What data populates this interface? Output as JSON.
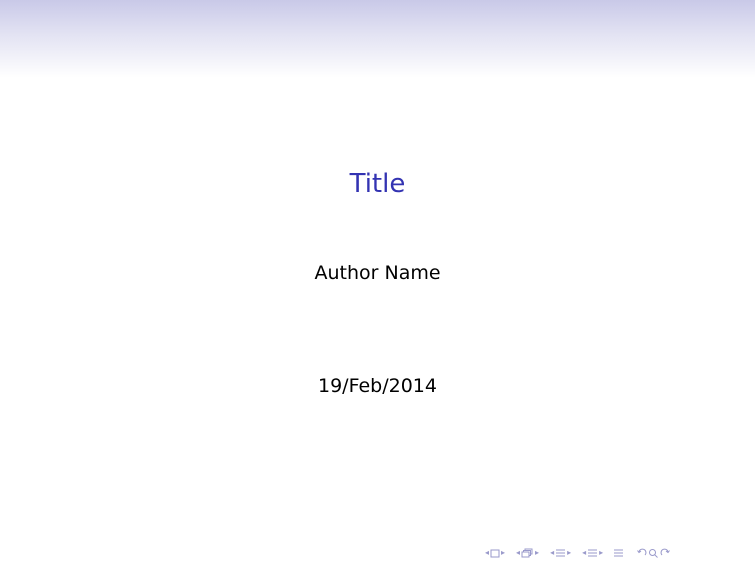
{
  "slide": {
    "title": "Title",
    "author": "Author Name",
    "date": "19/Feb/2014"
  },
  "colors": {
    "title": "#3333b2",
    "header_gradient_top": "#c9c9e8",
    "nav_icons": "#9a9acb"
  },
  "navigation": {
    "icons": [
      "frame-nav-icon",
      "subsection-nav-icon",
      "section-nav-icon",
      "document-nav-icon",
      "appendix-nav-icon",
      "search-zoom-icon"
    ]
  }
}
